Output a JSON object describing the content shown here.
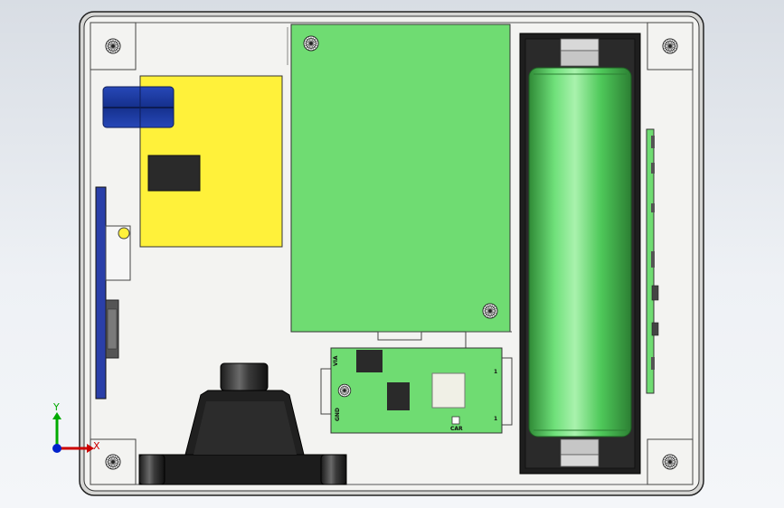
{
  "board_labels": {
    "via": "VIA",
    "gnd": "GND",
    "car": "CAR",
    "pin_upper": "1",
    "pin_lower": "1"
  },
  "axes": {
    "x_label": "X",
    "y_label": "Y"
  },
  "colors": {
    "enclosure_fill": "#f3f3f1",
    "main_pcb": "#6fdc72",
    "yellow_module": "#fff13a",
    "battery": "#56c95e",
    "battery_holder": "#1e1e1e",
    "blue_strip": "#2a3fa8",
    "capacitor": "#1f3a9c",
    "axis_x": "#cc0000",
    "axis_y": "#00aa00",
    "axis_origin": "#0022cc"
  },
  "icons": [
    "screw-head-icon",
    "axis-triad-icon"
  ]
}
